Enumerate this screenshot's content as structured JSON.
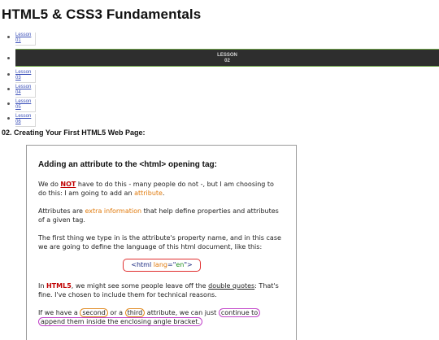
{
  "page": {
    "title": "HTML5 & CSS3 Fundamentals"
  },
  "nav": {
    "items": [
      {
        "label_line1": "Lesson",
        "label_line2": "01",
        "active": false
      },
      {
        "label_line1": "LESSON",
        "label_line2": "02",
        "active": true
      },
      {
        "label_line1": "Lesson",
        "label_line2": "03",
        "active": false
      },
      {
        "label_line1": "Lesson",
        "label_line2": "04",
        "active": false
      },
      {
        "label_line1": "Lesson",
        "label_line2": "05",
        "active": false
      },
      {
        "label_line1": "Lesson",
        "label_line2": "06",
        "active": false
      }
    ]
  },
  "section": {
    "title": "02. Creating Your First HTML5 Web Page:"
  },
  "slide": {
    "heading": "Adding an attribute to the <html> opening tag:",
    "p1": {
      "a": "We do ",
      "not": "NOT",
      "b": " have to do this - many people do not -, but I am choosing to do this: I am going to add an ",
      "attr": "attribute",
      "c": "."
    },
    "p2": {
      "a": "Attributes are ",
      "extra": "extra information",
      "b": " that help define properties and attributes of a given tag."
    },
    "p3": "The first thing we type in is the attribute's property name, and in this case we are going to define the language of this html document, like this:",
    "code": {
      "a": "<html ",
      "attr": "lang",
      "eq": "=\"",
      "val": "en",
      "close": "\">"
    },
    "p4": {
      "a": "In ",
      "html5": "HTML5",
      "b": ", we might see some people leave off the ",
      "dq": "double quotes",
      "c": ": That's fine. I've chosen to include them for technical reasons."
    },
    "p5": {
      "a": "If we have a ",
      "second": "second",
      "b": " or a ",
      "third": "third",
      "c": " attribute, we can just ",
      "cont": "continue to",
      "d": " ",
      "append": "append them inside the enclosing angle bracket."
    }
  }
}
